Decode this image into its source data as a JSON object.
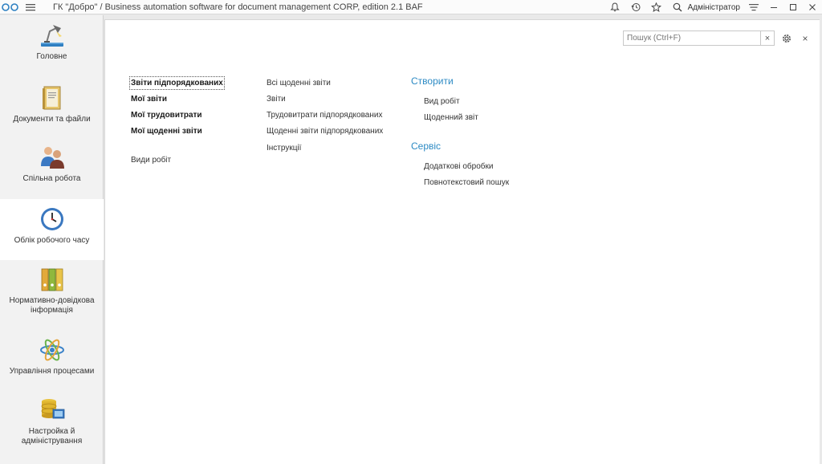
{
  "titlebar": {
    "app_title": "ГК \"Добро\" / Business automation software for document management CORP, edition 2.1 BAF",
    "user": "Адміністратор",
    "icons": [
      "bell-icon",
      "history-icon",
      "star-icon",
      "search-icon",
      "menu-lines-icon",
      "minimize-icon",
      "maximize-icon",
      "close-icon"
    ]
  },
  "sidebar": {
    "items": [
      {
        "label": "Головне",
        "icon": "desk-lamp-icon"
      },
      {
        "label": "Документи та файли",
        "icon": "documents-icon"
      },
      {
        "label": "Спільна робота",
        "icon": "people-icon"
      },
      {
        "label": "Облік робочого часу",
        "icon": "clock-icon",
        "active": true
      },
      {
        "label": "Нормативно-довідкова інформація",
        "icon": "binders-icon"
      },
      {
        "label": "Управління процесами",
        "icon": "process-icon"
      },
      {
        "label": "Настройка й адміністрування",
        "icon": "database-settings-icon"
      }
    ]
  },
  "main": {
    "search_placeholder": "Пошук (Ctrl+F)",
    "col1": {
      "links": [
        "Звіти підпорядкованих",
        "Мої звіти",
        "Мої трудовитрати",
        "Мої щоденні звіти"
      ],
      "extra": "Види робіт"
    },
    "col2": {
      "links": [
        "Всі щоденні звіти",
        "Звіти",
        "Трудовитрати підпорядкованих",
        "Щоденні звіти підпорядкованих",
        "Інструкції"
      ]
    },
    "create": {
      "title": "Створити",
      "links": [
        "Вид робіт",
        "Щоденний звіт"
      ]
    },
    "service": {
      "title": "Сервіс",
      "links": [
        "Додаткові обробки",
        "Повнотекстовий пошук"
      ]
    }
  },
  "colors": {
    "accent": "#2c8ac4",
    "sidebar_bg": "#f2f2f2",
    "active_bg": "#ffffff"
  }
}
